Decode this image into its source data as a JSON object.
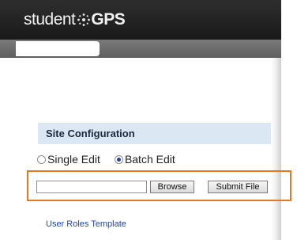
{
  "header": {
    "logo_prefix": "student",
    "logo_suffix": "GPS"
  },
  "section": {
    "title": "Site Configuration"
  },
  "edit_mode": {
    "options": [
      {
        "label": "Single Edit",
        "checked": false
      },
      {
        "label": "Batch Edit",
        "checked": true
      }
    ]
  },
  "upload": {
    "file_value": "",
    "browse_label": "Browse",
    "submit_label": "Submit File"
  },
  "links": {
    "user_roles_template": "User Roles Template"
  },
  "colors": {
    "header_bg": "#222222",
    "nav_bg": "#6b6b6b",
    "section_bg": "#dbe7f3",
    "highlight": "#e87722",
    "link": "#23459b"
  },
  "icons": {
    "logo_mark": "gps-star-icon"
  }
}
